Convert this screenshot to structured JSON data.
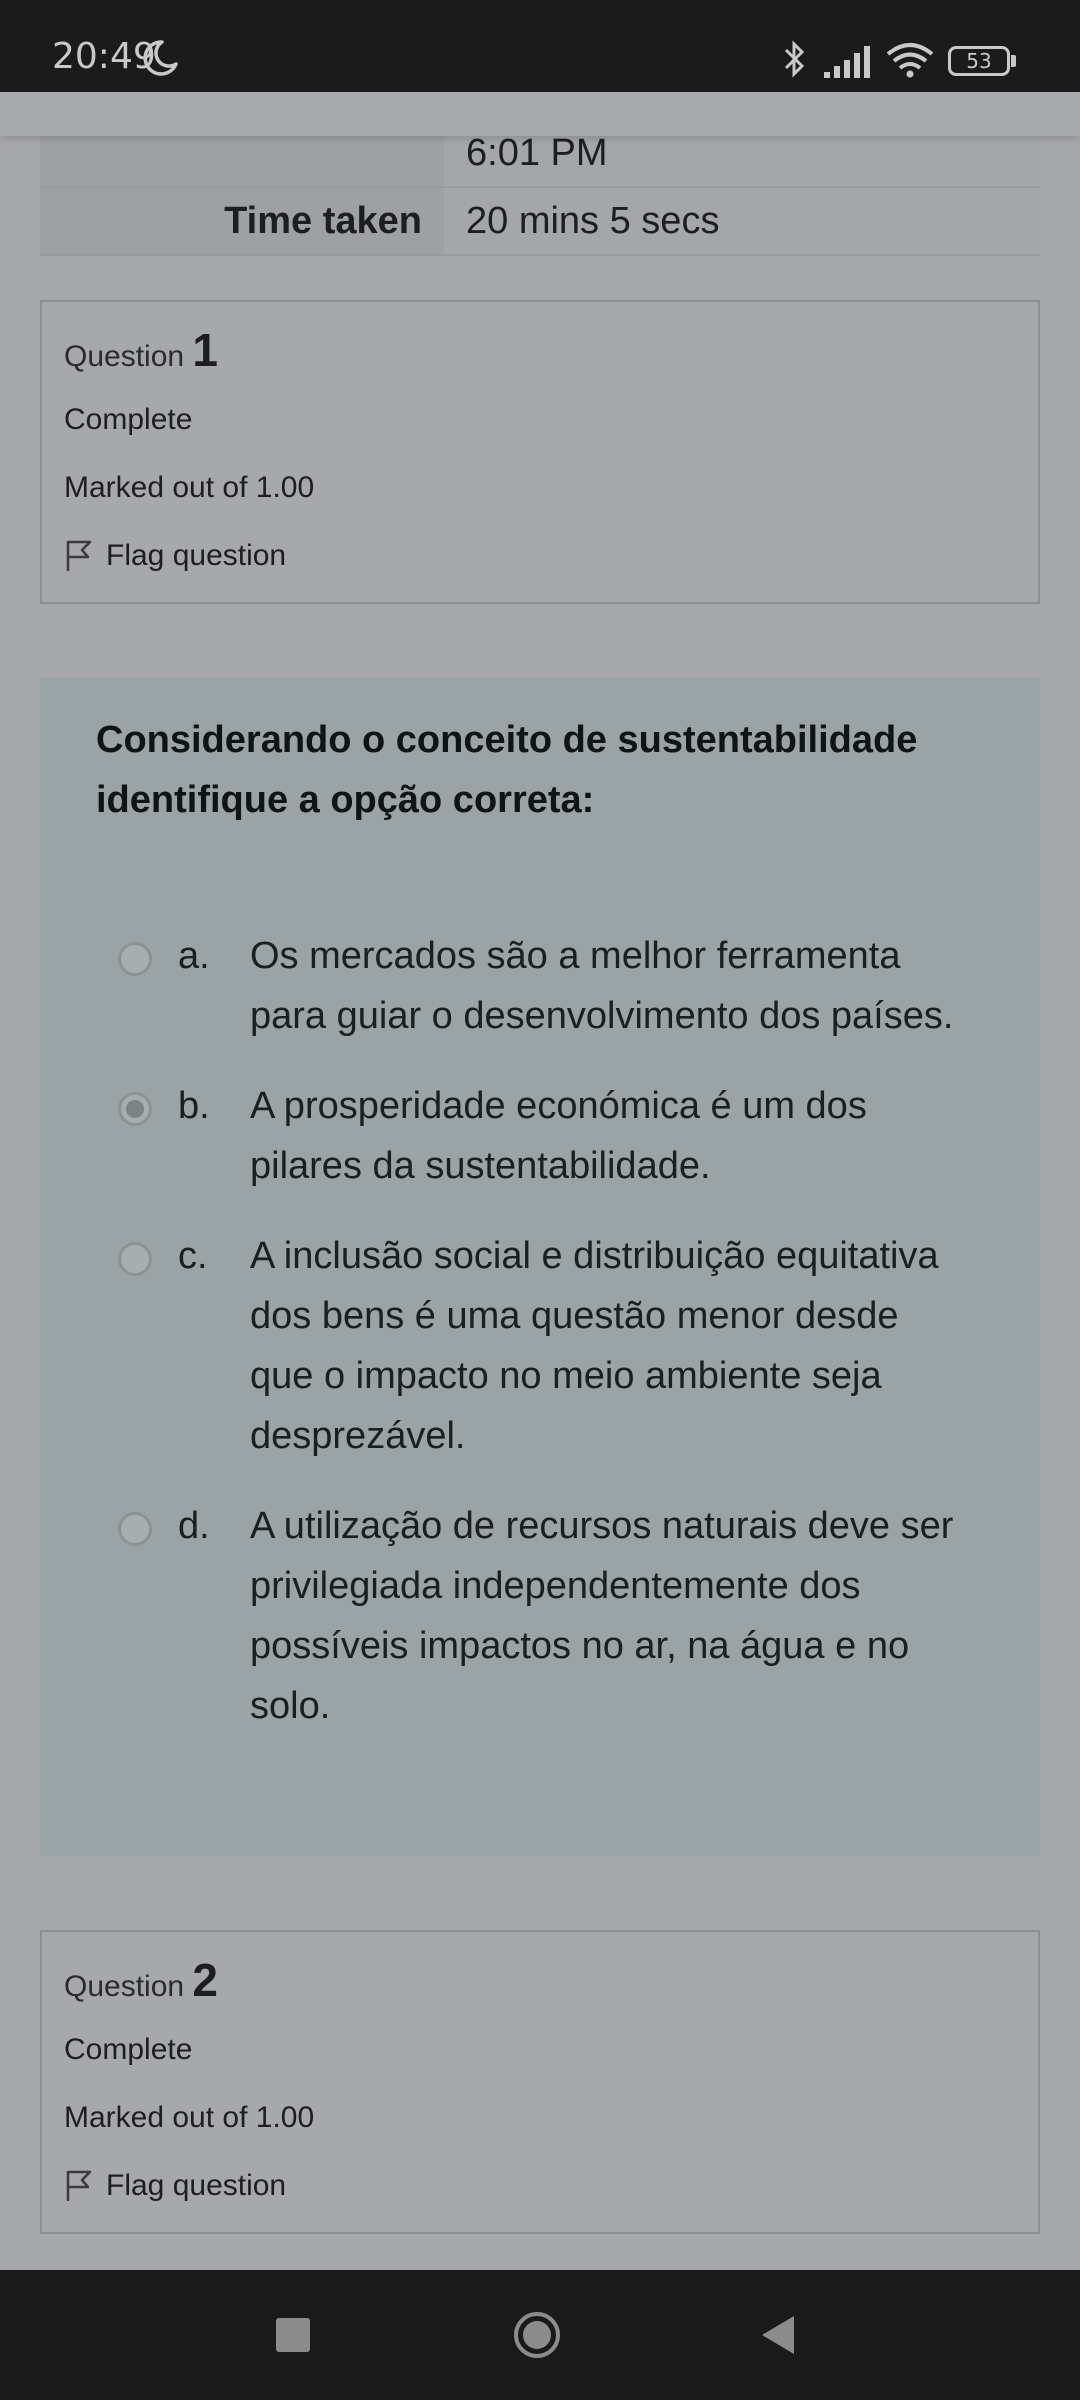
{
  "status": {
    "time": "20:49",
    "battery": "53",
    "icons": [
      "moon-icon",
      "bluetooth-icon",
      "signal-icon",
      "wifi-icon",
      "battery-icon"
    ]
  },
  "summary": {
    "rows": [
      {
        "label": "",
        "value": "6:01 PM"
      },
      {
        "label": "Time taken",
        "value": "20 mins 5 secs"
      }
    ]
  },
  "question1_info": {
    "prefix": "Question",
    "number": "1",
    "state": "Complete",
    "grade": "Marked out of 1.00",
    "flag_label": "Flag question"
  },
  "question1": {
    "text": "Considerando o conceito de sustentabilidade identifique a opção correta:",
    "answers": [
      {
        "letter": "a.",
        "text": "Os mercados são a melhor ferramenta para guiar o desenvolvimento dos países.",
        "selected": false
      },
      {
        "letter": "b.",
        "text": "A prosperidade económica é um dos pilares da sustentabilidade.",
        "selected": true
      },
      {
        "letter": "c.",
        "text": "A inclusão social e distribuição equitativa dos bens é uma questão menor desde que o impacto no meio ambiente seja desprezável.",
        "selected": false
      },
      {
        "letter": "d.",
        "text": "A utilização de recursos naturais deve ser privilegiada independentemente dos possíveis impactos no ar, na água e no solo.",
        "selected": false
      }
    ]
  },
  "question2_info": {
    "prefix": "Question",
    "number": "2",
    "state": "Complete",
    "grade": "Marked out of 1.00",
    "flag_label": "Flag question"
  },
  "navbar": {
    "icons": [
      "recents-icon",
      "home-icon",
      "back-icon"
    ]
  }
}
